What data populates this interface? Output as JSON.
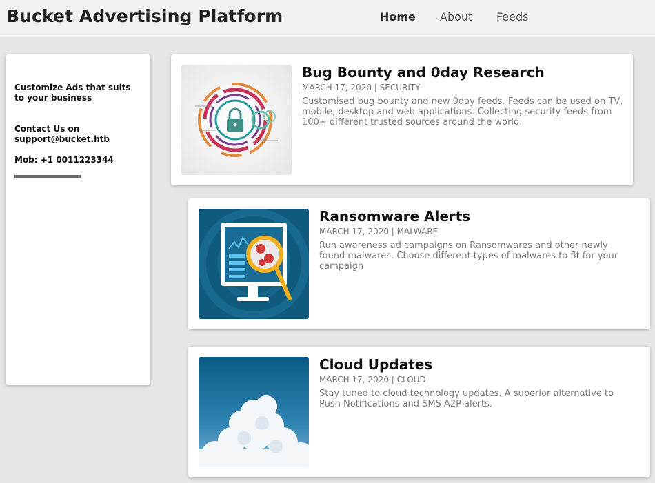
{
  "header": {
    "brand": "Bucket Advertising Platform",
    "nav": [
      {
        "label": "Home",
        "active": true
      },
      {
        "label": "About",
        "active": false
      },
      {
        "label": "Feeds",
        "active": false
      }
    ]
  },
  "sidebar": {
    "tagline": "Customize Ads that suits to your business",
    "contact_prefix": "Contact Us on",
    "contact_email": "support@bucket.htb",
    "mobile": "Mob: +1 0011223344"
  },
  "posts": [
    {
      "title": "Bug Bounty and 0day Research",
      "date": "MARCH 17, 2020",
      "category": "SECURITY",
      "meta": "MARCH 17, 2020 | SECURITY",
      "description": "Customised bug bounty and new 0day feeds. Feeds can be used on TV, mobile, desktop and web applications. Collecting security feeds from 100+ different trusted sources around the world.",
      "image": "security-lock-icon"
    },
    {
      "title": "Ransomware Alerts",
      "date": "MARCH 17, 2020",
      "category": "MALWARE",
      "meta": "MARCH 17, 2020 | MALWARE",
      "description": "Run awareness ad campaigns on Ransomwares and other newly found malwares. Choose different types of malwares to fit for your campaign",
      "image": "malware-scan-icon"
    },
    {
      "title": "Cloud Updates",
      "date": "MARCH 17, 2020",
      "category": "CLOUD",
      "meta": "MARCH 17, 2020 | CLOUD",
      "description": "Stay tuned to cloud technology updates. A superior alternative to Push Notifications and SMS A2P alerts.",
      "image": "cloud-sky-image"
    }
  ],
  "colors": {
    "page_bg": "#e6e6e6",
    "header_bg": "#f1f1f1",
    "card_bg": "#ffffff",
    "meta_text": "#777777"
  }
}
